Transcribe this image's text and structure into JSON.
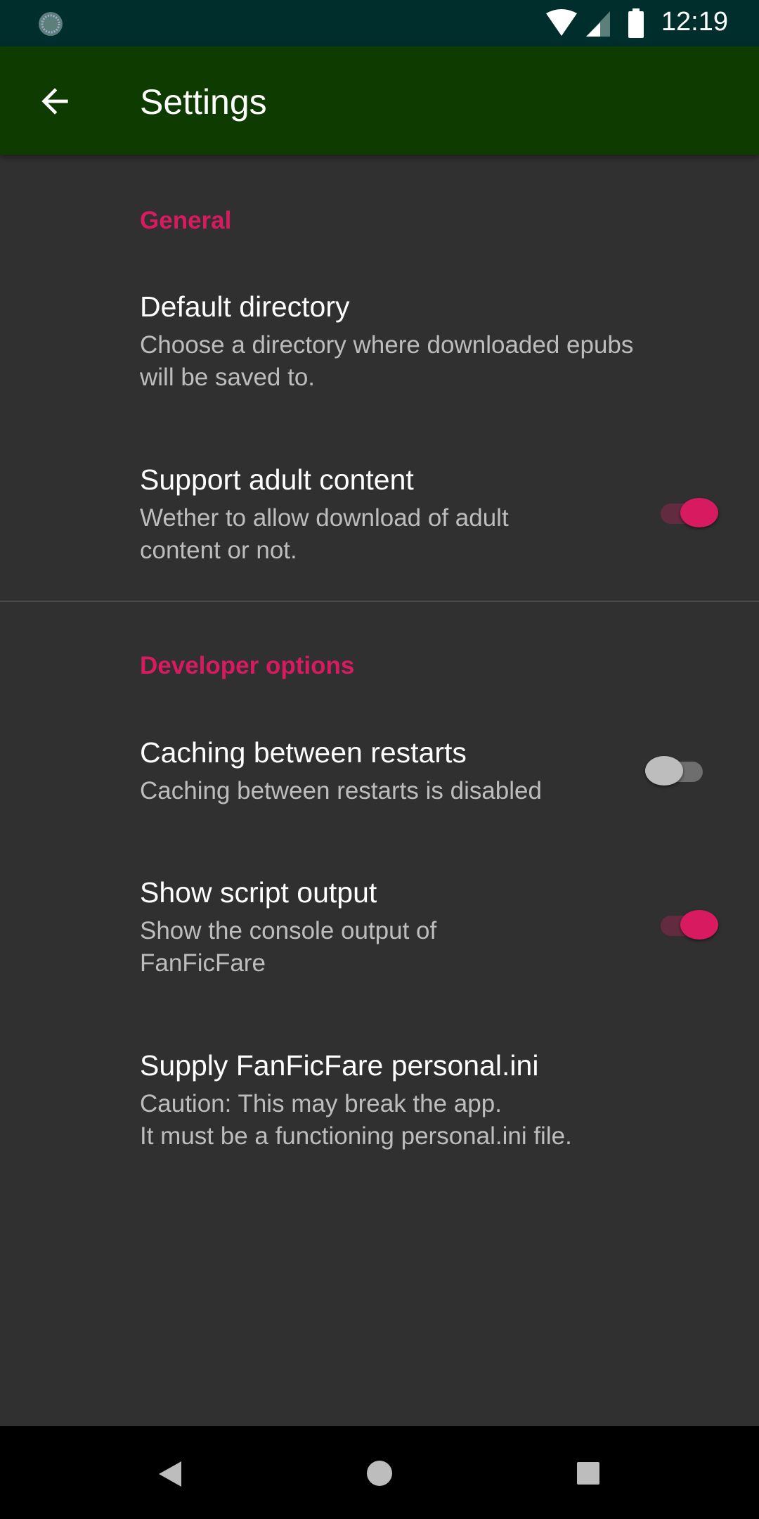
{
  "status_bar": {
    "time": "12:19",
    "icons": [
      "app-notification-icon",
      "wifi-icon",
      "cell-signal-icon",
      "battery-icon"
    ]
  },
  "app_bar": {
    "title": "Settings",
    "back_icon": "arrow-back-icon"
  },
  "accent_color": "#d81b60",
  "sections": [
    {
      "header": "General",
      "items": [
        {
          "title": "Default directory",
          "summary_lines": [
            "Choose a directory where downloaded epubs",
            "will be saved to."
          ]
        },
        {
          "title": "Support adult content",
          "summary_lines": [
            "Wether to allow download of adult",
            "content or not."
          ],
          "switch_on": true
        }
      ]
    },
    {
      "header": "Developer options",
      "items": [
        {
          "title": "Caching between restarts",
          "summary_lines": [
            "Caching between restarts is disabled"
          ],
          "switch_on": false
        },
        {
          "title": "Show script output",
          "summary_lines": [
            "Show the console output of",
            "FanFicFare"
          ],
          "switch_on": true
        },
        {
          "title": "Supply FanFicFare personal.ini",
          "summary_lines": [
            "Caution: This may break the app.",
            "It must be a functioning personal.ini file."
          ]
        }
      ]
    }
  ],
  "nav_bar": {
    "icons": [
      "back-triangle-icon",
      "home-circle-icon",
      "recents-square-icon"
    ]
  }
}
